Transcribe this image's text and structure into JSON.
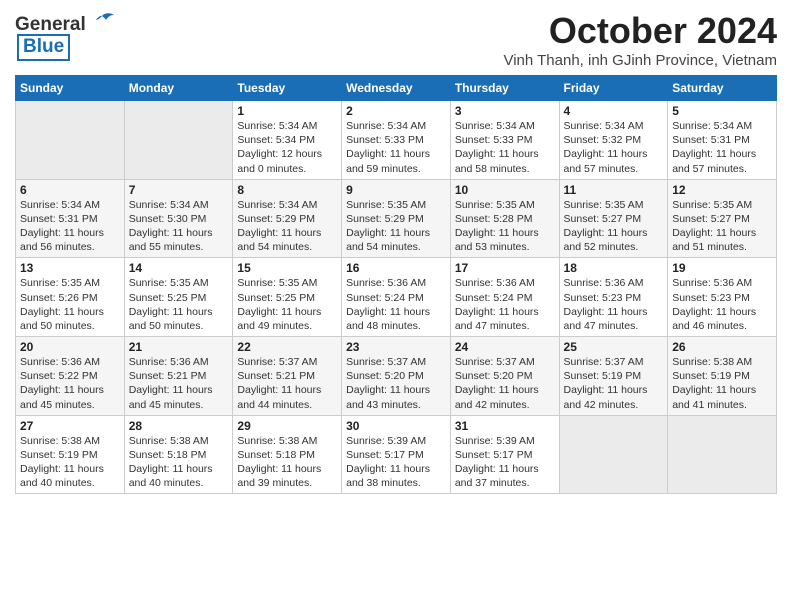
{
  "logo": {
    "line1": "General",
    "line2": "Blue"
  },
  "title": "October 2024",
  "subtitle": "Vinh Thanh, inh GJinh Province, Vietnam",
  "weekdays": [
    "Sunday",
    "Monday",
    "Tuesday",
    "Wednesday",
    "Thursday",
    "Friday",
    "Saturday"
  ],
  "weeks": [
    [
      {
        "day": "",
        "sunrise": "",
        "sunset": "",
        "daylight": ""
      },
      {
        "day": "",
        "sunrise": "",
        "sunset": "",
        "daylight": ""
      },
      {
        "day": "1",
        "sunrise": "Sunrise: 5:34 AM",
        "sunset": "Sunset: 5:34 PM",
        "daylight": "Daylight: 12 hours and 0 minutes."
      },
      {
        "day": "2",
        "sunrise": "Sunrise: 5:34 AM",
        "sunset": "Sunset: 5:33 PM",
        "daylight": "Daylight: 11 hours and 59 minutes."
      },
      {
        "day": "3",
        "sunrise": "Sunrise: 5:34 AM",
        "sunset": "Sunset: 5:33 PM",
        "daylight": "Daylight: 11 hours and 58 minutes."
      },
      {
        "day": "4",
        "sunrise": "Sunrise: 5:34 AM",
        "sunset": "Sunset: 5:32 PM",
        "daylight": "Daylight: 11 hours and 57 minutes."
      },
      {
        "day": "5",
        "sunrise": "Sunrise: 5:34 AM",
        "sunset": "Sunset: 5:31 PM",
        "daylight": "Daylight: 11 hours and 57 minutes."
      }
    ],
    [
      {
        "day": "6",
        "sunrise": "Sunrise: 5:34 AM",
        "sunset": "Sunset: 5:31 PM",
        "daylight": "Daylight: 11 hours and 56 minutes."
      },
      {
        "day": "7",
        "sunrise": "Sunrise: 5:34 AM",
        "sunset": "Sunset: 5:30 PM",
        "daylight": "Daylight: 11 hours and 55 minutes."
      },
      {
        "day": "8",
        "sunrise": "Sunrise: 5:34 AM",
        "sunset": "Sunset: 5:29 PM",
        "daylight": "Daylight: 11 hours and 54 minutes."
      },
      {
        "day": "9",
        "sunrise": "Sunrise: 5:35 AM",
        "sunset": "Sunset: 5:29 PM",
        "daylight": "Daylight: 11 hours and 54 minutes."
      },
      {
        "day": "10",
        "sunrise": "Sunrise: 5:35 AM",
        "sunset": "Sunset: 5:28 PM",
        "daylight": "Daylight: 11 hours and 53 minutes."
      },
      {
        "day": "11",
        "sunrise": "Sunrise: 5:35 AM",
        "sunset": "Sunset: 5:27 PM",
        "daylight": "Daylight: 11 hours and 52 minutes."
      },
      {
        "day": "12",
        "sunrise": "Sunrise: 5:35 AM",
        "sunset": "Sunset: 5:27 PM",
        "daylight": "Daylight: 11 hours and 51 minutes."
      }
    ],
    [
      {
        "day": "13",
        "sunrise": "Sunrise: 5:35 AM",
        "sunset": "Sunset: 5:26 PM",
        "daylight": "Daylight: 11 hours and 50 minutes."
      },
      {
        "day": "14",
        "sunrise": "Sunrise: 5:35 AM",
        "sunset": "Sunset: 5:25 PM",
        "daylight": "Daylight: 11 hours and 50 minutes."
      },
      {
        "day": "15",
        "sunrise": "Sunrise: 5:35 AM",
        "sunset": "Sunset: 5:25 PM",
        "daylight": "Daylight: 11 hours and 49 minutes."
      },
      {
        "day": "16",
        "sunrise": "Sunrise: 5:36 AM",
        "sunset": "Sunset: 5:24 PM",
        "daylight": "Daylight: 11 hours and 48 minutes."
      },
      {
        "day": "17",
        "sunrise": "Sunrise: 5:36 AM",
        "sunset": "Sunset: 5:24 PM",
        "daylight": "Daylight: 11 hours and 47 minutes."
      },
      {
        "day": "18",
        "sunrise": "Sunrise: 5:36 AM",
        "sunset": "Sunset: 5:23 PM",
        "daylight": "Daylight: 11 hours and 47 minutes."
      },
      {
        "day": "19",
        "sunrise": "Sunrise: 5:36 AM",
        "sunset": "Sunset: 5:23 PM",
        "daylight": "Daylight: 11 hours and 46 minutes."
      }
    ],
    [
      {
        "day": "20",
        "sunrise": "Sunrise: 5:36 AM",
        "sunset": "Sunset: 5:22 PM",
        "daylight": "Daylight: 11 hours and 45 minutes."
      },
      {
        "day": "21",
        "sunrise": "Sunrise: 5:36 AM",
        "sunset": "Sunset: 5:21 PM",
        "daylight": "Daylight: 11 hours and 45 minutes."
      },
      {
        "day": "22",
        "sunrise": "Sunrise: 5:37 AM",
        "sunset": "Sunset: 5:21 PM",
        "daylight": "Daylight: 11 hours and 44 minutes."
      },
      {
        "day": "23",
        "sunrise": "Sunrise: 5:37 AM",
        "sunset": "Sunset: 5:20 PM",
        "daylight": "Daylight: 11 hours and 43 minutes."
      },
      {
        "day": "24",
        "sunrise": "Sunrise: 5:37 AM",
        "sunset": "Sunset: 5:20 PM",
        "daylight": "Daylight: 11 hours and 42 minutes."
      },
      {
        "day": "25",
        "sunrise": "Sunrise: 5:37 AM",
        "sunset": "Sunset: 5:19 PM",
        "daylight": "Daylight: 11 hours and 42 minutes."
      },
      {
        "day": "26",
        "sunrise": "Sunrise: 5:38 AM",
        "sunset": "Sunset: 5:19 PM",
        "daylight": "Daylight: 11 hours and 41 minutes."
      }
    ],
    [
      {
        "day": "27",
        "sunrise": "Sunrise: 5:38 AM",
        "sunset": "Sunset: 5:19 PM",
        "daylight": "Daylight: 11 hours and 40 minutes."
      },
      {
        "day": "28",
        "sunrise": "Sunrise: 5:38 AM",
        "sunset": "Sunset: 5:18 PM",
        "daylight": "Daylight: 11 hours and 40 minutes."
      },
      {
        "day": "29",
        "sunrise": "Sunrise: 5:38 AM",
        "sunset": "Sunset: 5:18 PM",
        "daylight": "Daylight: 11 hours and 39 minutes."
      },
      {
        "day": "30",
        "sunrise": "Sunrise: 5:39 AM",
        "sunset": "Sunset: 5:17 PM",
        "daylight": "Daylight: 11 hours and 38 minutes."
      },
      {
        "day": "31",
        "sunrise": "Sunrise: 5:39 AM",
        "sunset": "Sunset: 5:17 PM",
        "daylight": "Daylight: 11 hours and 37 minutes."
      },
      {
        "day": "",
        "sunrise": "",
        "sunset": "",
        "daylight": ""
      },
      {
        "day": "",
        "sunrise": "",
        "sunset": "",
        "daylight": ""
      }
    ]
  ]
}
